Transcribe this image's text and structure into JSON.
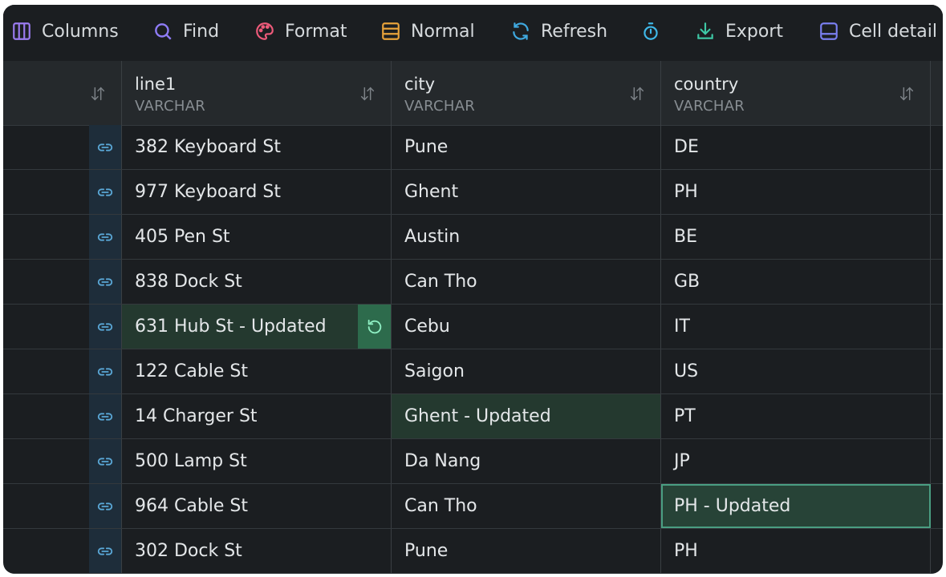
{
  "toolbar": {
    "columns": {
      "label": "Columns",
      "icon": "columns-icon",
      "color": "#9b7bf0"
    },
    "find": {
      "label": "Find",
      "icon": "search-icon",
      "color": "#8f7cf7"
    },
    "format": {
      "label": "Format",
      "icon": "palette-icon",
      "color": "#ee5a7a"
    },
    "normal": {
      "label": "Normal",
      "icon": "density-icon",
      "color": "#e8a33a"
    },
    "refresh": {
      "label": "Refresh",
      "icon": "refresh-icon",
      "color": "#3fa9e0"
    },
    "timer": {
      "icon": "stopwatch-icon",
      "color": "#3fb8e8"
    },
    "export": {
      "label": "Export",
      "icon": "download-icon",
      "color": "#3ec9a6"
    },
    "cell_detail": {
      "label": "Cell detail",
      "icon": "panel-bottom-icon",
      "color": "#7a7ff0"
    }
  },
  "columns": [
    {
      "name": "line1",
      "type": "VARCHAR"
    },
    {
      "name": "city",
      "type": "VARCHAR"
    },
    {
      "name": "country",
      "type": "VARCHAR"
    }
  ],
  "rows": [
    {
      "line1": "382 Keyboard St",
      "city": "Pune",
      "country": "DE"
    },
    {
      "line1": "977 Keyboard St",
      "city": "Ghent",
      "country": "PH"
    },
    {
      "line1": "405 Pen St",
      "city": "Austin",
      "country": "BE"
    },
    {
      "line1": "838 Dock St",
      "city": "Can Tho",
      "country": "GB"
    },
    {
      "line1": "631 Hub St - Updated",
      "city": "Cebu",
      "country": "IT"
    },
    {
      "line1": "122 Cable St",
      "city": "Saigon",
      "country": "US"
    },
    {
      "line1": "14 Charger St",
      "city": "Ghent - Updated",
      "country": "PT"
    },
    {
      "line1": "500 Lamp St",
      "city": "Da Nang",
      "country": "JP"
    },
    {
      "line1": "964 Cable St",
      "city": "Can Tho",
      "country": "PH - Updated"
    },
    {
      "line1": "302 Dock St",
      "city": "Pune",
      "country": "PH"
    }
  ],
  "colors": {
    "background": "#1b1e21",
    "header": "#25292c",
    "updated_cell": "#24392f",
    "selected_border": "#4a9e82",
    "revert_button": "#2d6b4c",
    "link_column": "#1e2d3a"
  }
}
